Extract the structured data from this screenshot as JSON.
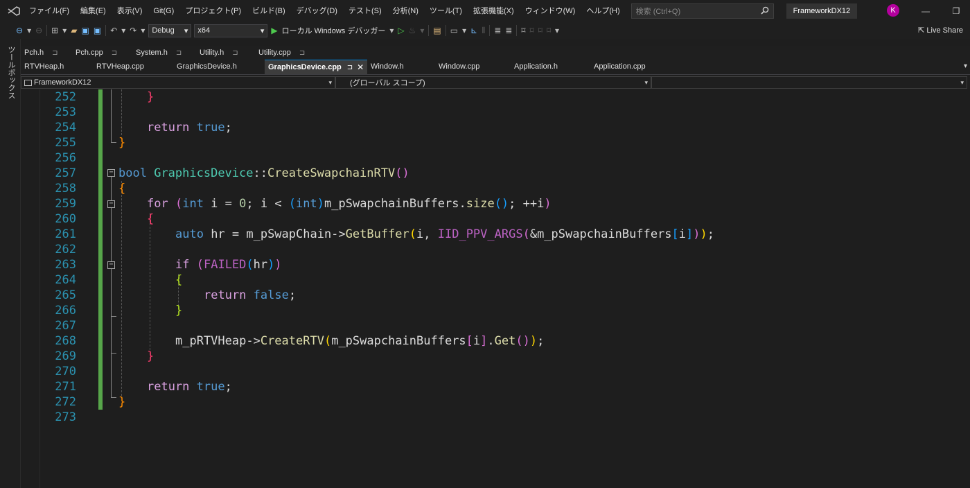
{
  "menubar": {
    "items": [
      "ファイル(F)",
      "編集(E)",
      "表示(V)",
      "Git(G)",
      "プロジェクト(P)",
      "ビルド(B)",
      "デバッグ(D)",
      "テスト(S)",
      "分析(N)",
      "ツール(T)",
      "拡張機能(X)",
      "ウィンドウ(W)",
      "ヘルプ(H)"
    ],
    "search_placeholder": "検索 (Ctrl+Q)",
    "project_title": "FrameworkDX12",
    "avatar_initial": "K"
  },
  "toolbar": {
    "configuration": "Debug",
    "platform": "x64",
    "run_label": "ローカル Windows デバッガー",
    "live_share": "Live Share"
  },
  "toolbox": {
    "label": "ツールボックス"
  },
  "tabs_pinned": [
    {
      "label": "Pch.h"
    },
    {
      "label": "Pch.cpp"
    },
    {
      "label": "System.h"
    },
    {
      "label": "Utility.h"
    },
    {
      "label": "Utility.cpp"
    }
  ],
  "tabs": [
    {
      "label": "RTVHeap.h"
    },
    {
      "label": "RTVHeap.cpp"
    },
    {
      "label": "GraphicsDevice.h"
    },
    {
      "label": "GraphicsDevice.cpp",
      "active": true
    },
    {
      "label": "Window.h"
    },
    {
      "label": "Window.cpp"
    },
    {
      "label": "Application.h"
    },
    {
      "label": "Application.cpp"
    }
  ],
  "navbar": {
    "project": "FrameworkDX12",
    "scope": "(グローバル スコープ)",
    "member": ""
  },
  "editor": {
    "lines": [
      {
        "num": "252",
        "text": "}"
      },
      {
        "num": "253",
        "text": ""
      },
      {
        "num": "254",
        "text": "return true;"
      },
      {
        "num": "255",
        "text": "}"
      },
      {
        "num": "256",
        "text": ""
      },
      {
        "num": "257",
        "text": "bool GraphicsDevice::CreateSwapchainRTV()"
      },
      {
        "num": "258",
        "text": "{"
      },
      {
        "num": "259",
        "text": "for (int i = 0; i < (int)m_pSwapchainBuffers.size(); ++i)"
      },
      {
        "num": "260",
        "text": "{"
      },
      {
        "num": "261",
        "text": "auto hr = m_pSwapChain->GetBuffer(i, IID_PPV_ARGS(&m_pSwapchainBuffers[i]));"
      },
      {
        "num": "262",
        "text": ""
      },
      {
        "num": "263",
        "text": "if (FAILED(hr))"
      },
      {
        "num": "264",
        "text": "{"
      },
      {
        "num": "265",
        "text": "return false;"
      },
      {
        "num": "266",
        "text": "}"
      },
      {
        "num": "267",
        "text": ""
      },
      {
        "num": "268",
        "text": "m_pRTVHeap->CreateRTV(m_pSwapchainBuffers[i].Get());"
      },
      {
        "num": "269",
        "text": "}"
      },
      {
        "num": "270",
        "text": ""
      },
      {
        "num": "271",
        "text": "return true;"
      },
      {
        "num": "272",
        "text": "}"
      },
      {
        "num": "273",
        "text": ""
      }
    ]
  },
  "icons": {
    "logo": "visual-studio-logo-icon",
    "search": "search-icon",
    "run": "play-icon",
    "fold": "collapse-box-icon"
  },
  "colors": {
    "background": "#1e1e1e",
    "line_number": "#2b91af",
    "keyword": "#569cd6",
    "type_name": "#4ec9b0",
    "function": "#dcdcaa",
    "change_bar": "#57a64a",
    "accent": "#007acc"
  }
}
